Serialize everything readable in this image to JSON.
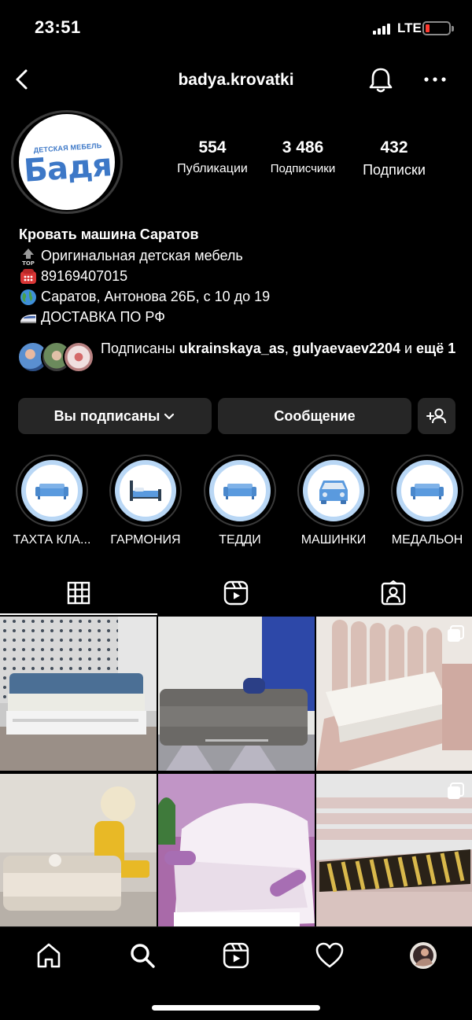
{
  "status_bar": {
    "time": "23:51",
    "network": "LTE",
    "battery_color": "#ff3b30"
  },
  "header": {
    "username": "badya.krovatki",
    "back_icon": "chevron-left-icon",
    "bell_icon": "bell-icon",
    "more_icon": "more-horizontal-icon"
  },
  "profile": {
    "logo_subtitle": "ДЕТСКАЯ МЕБЕЛЬ",
    "logo_title": "Бадя",
    "brand_color": "#3d78c7",
    "stats": [
      {
        "value": "554",
        "label": "Публикации"
      },
      {
        "value": "3 486",
        "label": "Подписчики"
      },
      {
        "value": "432",
        "label": "Подписки"
      }
    ]
  },
  "bio": {
    "name": "Кровать машина Саратов",
    "lines": [
      {
        "icon": "top-arrow-emoji",
        "text": "Оригинальная детская мебель"
      },
      {
        "icon": "telephone-emoji",
        "text": "89169407015"
      },
      {
        "icon": "globe-emoji",
        "text": "Саратов, Антонова 26Б, с 10 до 19"
      },
      {
        "icon": "train-emoji",
        "text": "ДОСТАВКА ПО РФ"
      }
    ]
  },
  "followed_by": {
    "prefix": "Подписаны ",
    "user1": "ukrainskaya_as",
    "separator": ", ",
    "user2": "gulyaevaev2204",
    "and": " и ",
    "more": "ещё 1"
  },
  "actions": {
    "following_label": "Вы подписаны",
    "message_label": "Сообщение",
    "add_user_icon": "add-user-icon"
  },
  "highlights": [
    {
      "label": "ТАХТА КЛА...",
      "icon": "sofa-icon"
    },
    {
      "label": "ГАРМОНИЯ",
      "icon": "bed-icon"
    },
    {
      "label": "ТЕДДИ",
      "icon": "sofa-icon"
    },
    {
      "label": "МАШИНКИ",
      "icon": "car-icon"
    },
    {
      "label": "МЕДАЛЬОН",
      "icon": "sofa-icon"
    }
  ],
  "tabs": [
    {
      "icon": "grid-icon",
      "active": true
    },
    {
      "icon": "reels-icon",
      "active": false
    },
    {
      "icon": "tagged-icon",
      "active": false
    }
  ],
  "posts": [
    {
      "subject": "white sofa bed with blue cushions",
      "multi": false
    },
    {
      "subject": "grey sofa bed with blue curtains",
      "multi": false
    },
    {
      "subject": "pink upholstered bed with mattress",
      "multi": true
    },
    {
      "subject": "beige sofa bed with yellow armchair",
      "multi": false
    },
    {
      "subject": "pink sofa bed with bolster pillows",
      "multi": false
    },
    {
      "subject": "pink bed with slatted base",
      "multi": true
    }
  ],
  "bottom_nav": [
    "home-icon",
    "search-icon",
    "reels-icon",
    "heart-icon",
    "profile-avatar"
  ]
}
